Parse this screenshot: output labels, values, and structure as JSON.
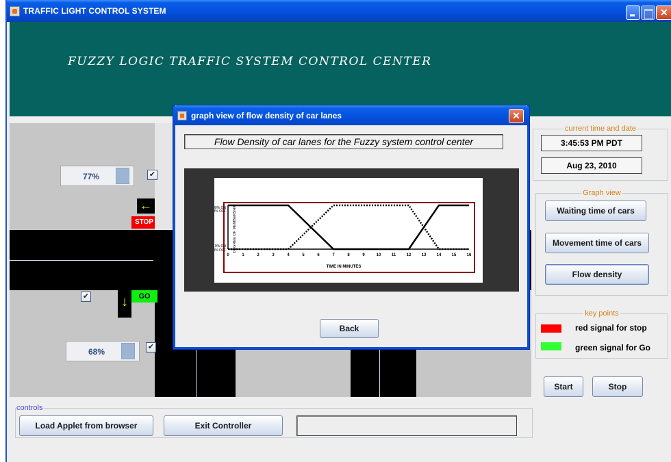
{
  "window": {
    "title": "TRAFFIC LIGHT CONTROL SYSTEM",
    "banner_heading": "FUZZY LOGIC TRAFFIC SYSTEM CONTROL  CENTER"
  },
  "intersection": {
    "top_lane": {
      "progress_value": 0.77,
      "progress_label": "77%",
      "signal": "STOP",
      "checked": true
    },
    "bottom_lane": {
      "progress_value": 0.68,
      "progress_label": "68%",
      "signal": "GO",
      "checked": true
    }
  },
  "time_panel": {
    "legend": "current time and date",
    "time": "3:45:53 PM PDT",
    "date": "Aug 23, 2010"
  },
  "graph_panel": {
    "legend": "Graph view",
    "buttons": [
      "Waiting time of cars",
      "Movement time of cars",
      "Flow density"
    ]
  },
  "key_panel": {
    "legend": "key points",
    "items": [
      {
        "label": "red signal for stop",
        "color": "#ff0000"
      },
      {
        "label": "green signal for Go",
        "color": "#33ff33"
      }
    ]
  },
  "sim_buttons": {
    "start": "Start",
    "stop": "Stop"
  },
  "controls": {
    "legend": "controls",
    "load": "Load Applet from browser",
    "exit": "Exit Controller",
    "status_text": ""
  },
  "dialog": {
    "title": "graph view of flow density of car lanes",
    "heading": "Flow Density of car lanes for the Fuzzy system control center",
    "back": "Back"
  },
  "chart_data": {
    "type": "line",
    "xlabel": "TIME IN MINUTES",
    "ylabel": "DEGREE OF MEMBERSHIP",
    "y_tick_labels": [
      "100% ON 0% OFF",
      "0% ON 100% OFF"
    ],
    "xlim": [
      0,
      16
    ],
    "ylim": [
      0,
      1
    ],
    "x_ticks": [
      0,
      1,
      2,
      3,
      4,
      5,
      6,
      7,
      8,
      9,
      10,
      11,
      12,
      13,
      14,
      15,
      16
    ],
    "series": [
      {
        "style": "solid",
        "points": [
          [
            0,
            1
          ],
          [
            4,
            1
          ],
          [
            7,
            0
          ],
          [
            12,
            0
          ],
          [
            14,
            1
          ],
          [
            16,
            1
          ]
        ]
      },
      {
        "style": "dotted",
        "points": [
          [
            0,
            0
          ],
          [
            4,
            0
          ],
          [
            7,
            1
          ],
          [
            12,
            1
          ],
          [
            14,
            0
          ],
          [
            16,
            0
          ]
        ]
      }
    ],
    "grid": false,
    "legend": "none"
  }
}
